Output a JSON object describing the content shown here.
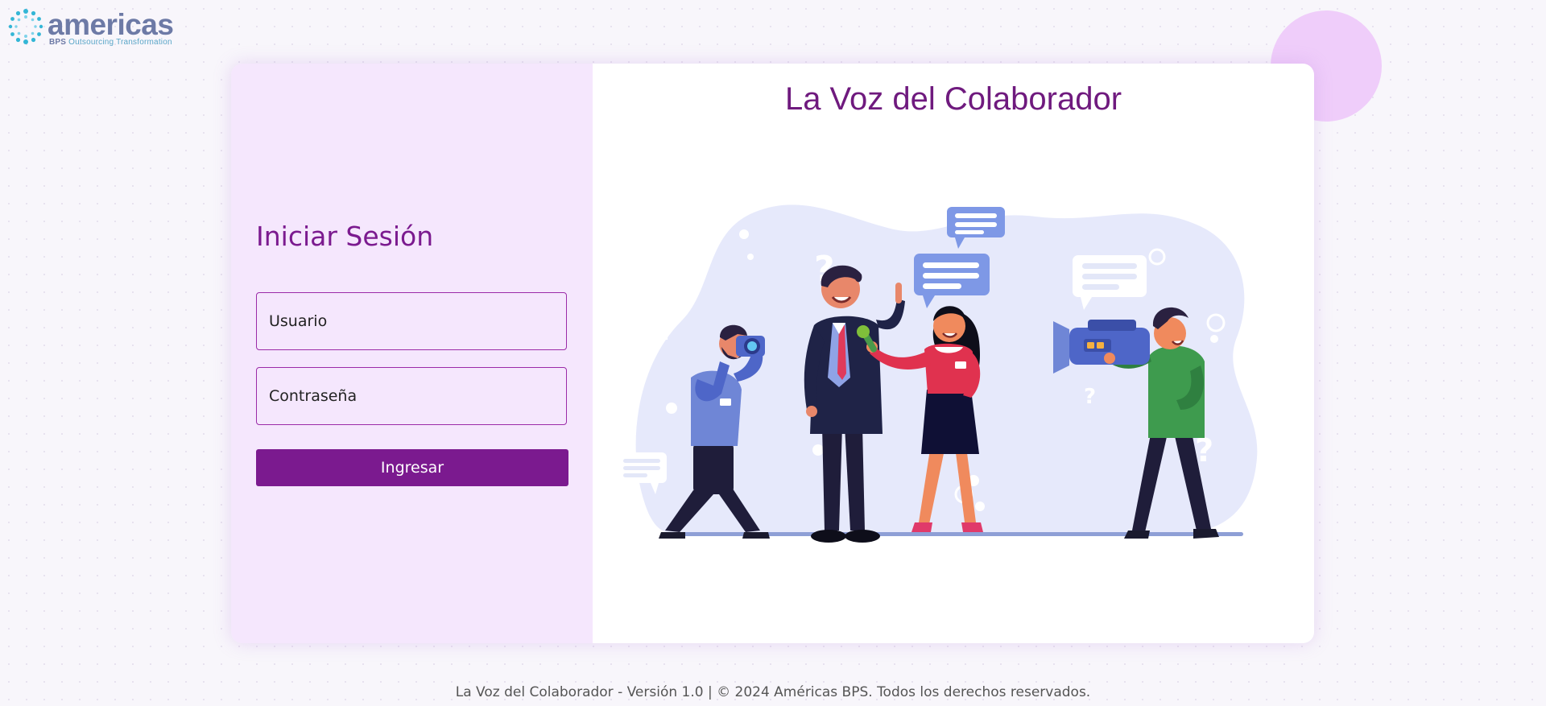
{
  "brand": {
    "name": "americas",
    "tagline_bold": "BPS",
    "tagline": "Outsourcing Transformation"
  },
  "login": {
    "title": "Iniciar Sesión",
    "username_placeholder": "Usuario",
    "password_placeholder": "Contraseña",
    "submit_label": "Ingresar"
  },
  "hero": {
    "title": "La Voz del Colaborador",
    "illustration": "press-interview-illustration"
  },
  "footer": {
    "text": "La Voz del Colaborador - Versión 1.0 | © 2024 Américas BPS. Todos los derechos reservados."
  },
  "colors": {
    "primary": "#7b1a8f",
    "panel": "#f5e7fd",
    "accent_circle": "#efcdfa",
    "logo": "#6d7aa6"
  }
}
